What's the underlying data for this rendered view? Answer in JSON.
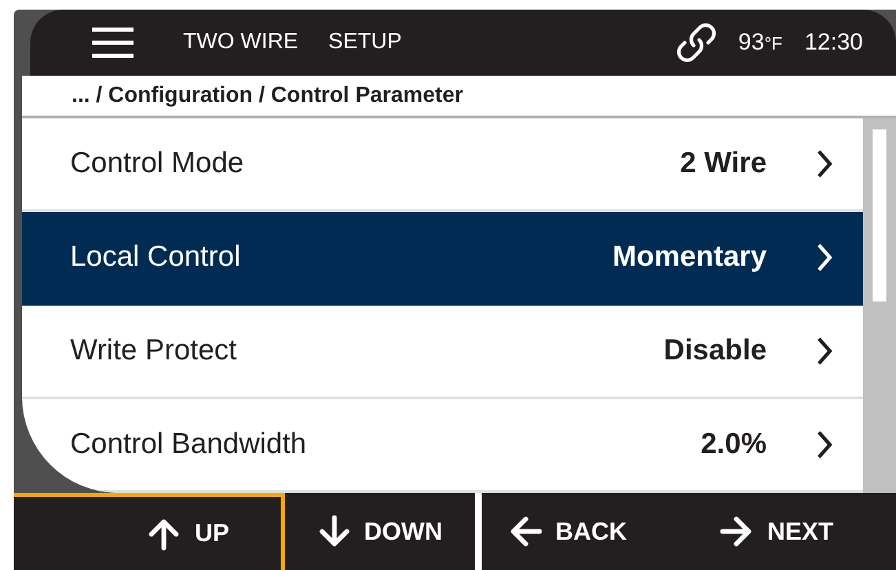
{
  "top_bar": {
    "tabs": [
      "TWO WIRE",
      "SETUP"
    ],
    "temperature": "93",
    "temperature_unit": "°F",
    "time": "12:30"
  },
  "breadcrumb": "... / Configuration / Control Parameter",
  "rows": [
    {
      "label": "Control Mode",
      "value": "2 Wire",
      "selected": false
    },
    {
      "label": "Local Control",
      "value": "Momentary",
      "selected": true
    },
    {
      "label": "Write Protect",
      "value": "Disable",
      "selected": false
    },
    {
      "label": "Control Bandwidth",
      "value": "2.0%",
      "selected": false
    }
  ],
  "buttons": [
    {
      "kind": "up",
      "label": "UP",
      "selected": true
    },
    {
      "kind": "down",
      "label": "DOWN",
      "selected": false
    },
    {
      "kind": "back",
      "label": "BACK",
      "selected": false
    },
    {
      "kind": "next",
      "label": "NEXT",
      "selected": false
    }
  ]
}
